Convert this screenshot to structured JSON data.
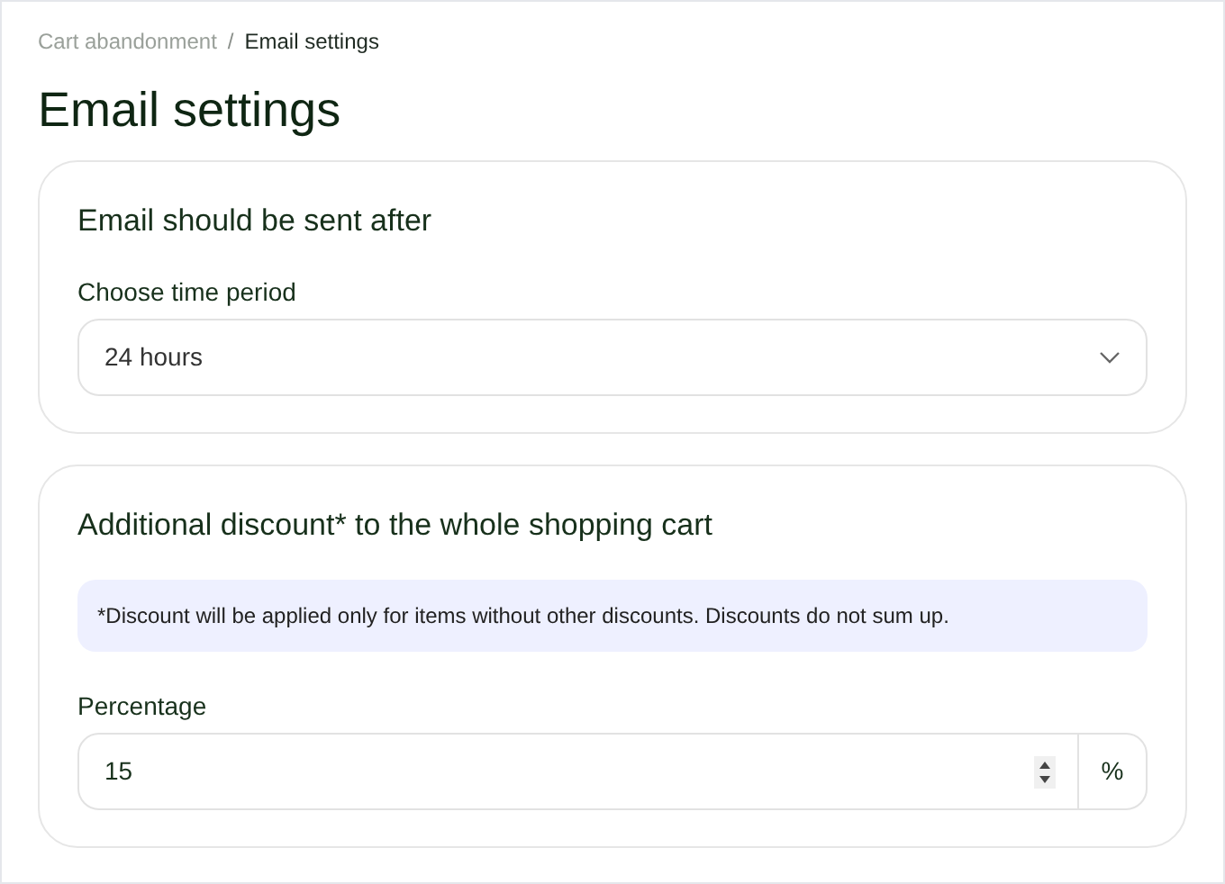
{
  "breadcrumb": [
    {
      "label": "Cart abandonment",
      "current": false
    },
    {
      "label": "Email settings",
      "current": true
    }
  ],
  "breadcrumb_separator": "/",
  "title": "Email settings",
  "send_after": {
    "heading": "Email should be sent after",
    "label": "Choose time period",
    "value": "24 hours"
  },
  "discount": {
    "heading": "Additional discount* to the whole shopping cart",
    "note": "*Discount will be applied only for items without other discounts. Discounts do not sum up.",
    "label": "Percentage",
    "value": "15",
    "unit": "%"
  }
}
